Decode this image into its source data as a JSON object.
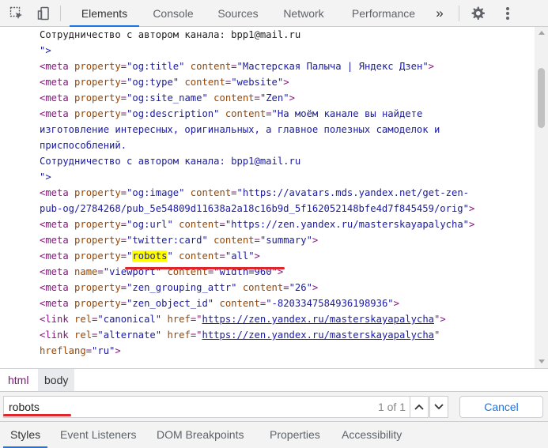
{
  "toolbar": {
    "tabs": [
      {
        "label": "Elements",
        "active": true
      },
      {
        "label": "Console"
      },
      {
        "label": "Sources"
      },
      {
        "label": "Network"
      },
      {
        "label": "Performance"
      }
    ],
    "more_tabs_label": "»",
    "icons": [
      "inspect-element-icon",
      "device-toolbar-icon",
      "settings-gear-icon",
      "more-menu-icon"
    ]
  },
  "dom_lines": [
    {
      "text": "Сотрудничество с автором канала: bpp1@mail.ru"
    },
    {
      "text": "\">"
    },
    {
      "tag_open": "<meta ",
      "a1": "property",
      "v1": "\"og:title\"",
      "a2": "content",
      "v2": "\"Мастерская Палыча | Яндекс Дзен\"",
      "close": ">"
    },
    {
      "tag_open": "<meta ",
      "a1": "property",
      "v1": "\"og:type\"",
      "a2": "content",
      "v2": "\"website\"",
      "close": ">"
    },
    {
      "tag_open": "<meta ",
      "a1": "property",
      "v1": "\"og:site_name\"",
      "a2": "content",
      "v2": "\"Zen\"",
      "close": ">"
    },
    {
      "tag_open": "<meta ",
      "a1": "property",
      "v1": "\"og:description\"",
      "a2": "content",
      "v2": "\"На моём канале вы найдете"
    },
    {
      "text": "изготовление интересных, оригинальных, а главное полезных самоделок и"
    },
    {
      "text": "приспособлений."
    },
    {
      "text": "Сотрудничество с автором канала: bpp1@mail.ru"
    },
    {
      "text": "\">"
    },
    {
      "tag_open": "<meta ",
      "a1": "property",
      "v1": "\"og:image\"",
      "a2": "content",
      "v2": "\"https://avatars.mds.yandex.net/get-zen-"
    },
    {
      "val_only": "pub-og/2784268/pub_5e54809d11638a2a18c16b9d_5f162052148bfe4d7f845459/orig\"",
      "close": ">"
    },
    {
      "tag_open": "<meta ",
      "a1": "property",
      "v1": "\"og:url\"",
      "a2": "content",
      "v2": "\"https://zen.yandex.ru/masterskayapalycha\"",
      "close": ">"
    },
    {
      "tag_open": "<meta ",
      "a1": "property",
      "v1": "\"twitter:card\"",
      "a2": "content",
      "v2": "\"summary\"",
      "close": ">"
    },
    {
      "tag_open": "<meta ",
      "a1": "property",
      "v1_pre": "\"",
      "v1_hl": "robots",
      "v1_post": "\"",
      "a2": "content",
      "v2": "\"all\"",
      "close": ">"
    },
    {
      "tag_open": "<meta ",
      "a1": "name",
      "v1": "\"viewport\"",
      "a2": "content",
      "v2": "\"width=960\"",
      "close": ">"
    },
    {
      "tag_open": "<meta ",
      "a1": "property",
      "v1": "\"zen_grouping_attr\"",
      "a2": "content",
      "v2": "\"26\"",
      "close": ">"
    },
    {
      "tag_open": "<meta ",
      "a1": "property",
      "v1": "\"zen_object_id\"",
      "a2": "content",
      "v2": "\"-8203347584936198936\"",
      "close": ">"
    },
    {
      "tag_open": "<link ",
      "a1": "rel",
      "v1": "\"canonical\"",
      "a2": "href",
      "link": "https://zen.yandex.ru/masterskayapalycha",
      "close": ">"
    },
    {
      "tag_open": "<link ",
      "a1": "rel",
      "v1": "\"alternate\"",
      "a2": "href",
      "link": "https://zen.yandex.ru/masterskayapalycha",
      "close": ""
    },
    {
      "a1": "hreflang",
      "v1": "\"ru\"",
      "close": ">"
    }
  ],
  "breadcrumb": [
    {
      "label": "html"
    },
    {
      "label": "body",
      "selected": true
    }
  ],
  "search": {
    "value": "robots",
    "match_count": "1 of 1",
    "cancel_label": "Cancel"
  },
  "bottom_tabs": [
    {
      "label": "Styles",
      "active": true
    },
    {
      "label": "Event Listeners"
    },
    {
      "label": "DOM Breakpoints"
    },
    {
      "label": "Properties"
    },
    {
      "label": "Accessibility"
    }
  ],
  "colors": {
    "accent": "#1a73e8",
    "tag": "#881280",
    "attr": "#994500",
    "value": "#1a1aa6",
    "highlight": "#ffff00",
    "annotation_red": "#e0262b"
  }
}
